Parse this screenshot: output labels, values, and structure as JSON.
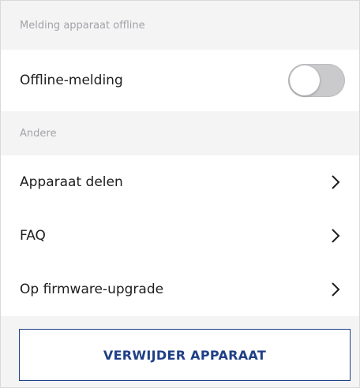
{
  "sections": {
    "offline_header": "Melding apparaat offline",
    "other_header": "Andere"
  },
  "rows": {
    "offline_notification": {
      "label": "Offline-melding",
      "toggle_on": false
    },
    "share_device": {
      "label": "Apparaat delen"
    },
    "faq": {
      "label": "FAQ"
    },
    "firmware_upgrade": {
      "label": "Op firmware-upgrade"
    }
  },
  "actions": {
    "delete_label": "VERWIJDER APPARAAT"
  },
  "colors": {
    "accent": "#1f3f86",
    "background": "#f4f4f5",
    "toggle_off": "#cacacd"
  },
  "icons": {
    "chevron": "chevron-right-icon"
  }
}
